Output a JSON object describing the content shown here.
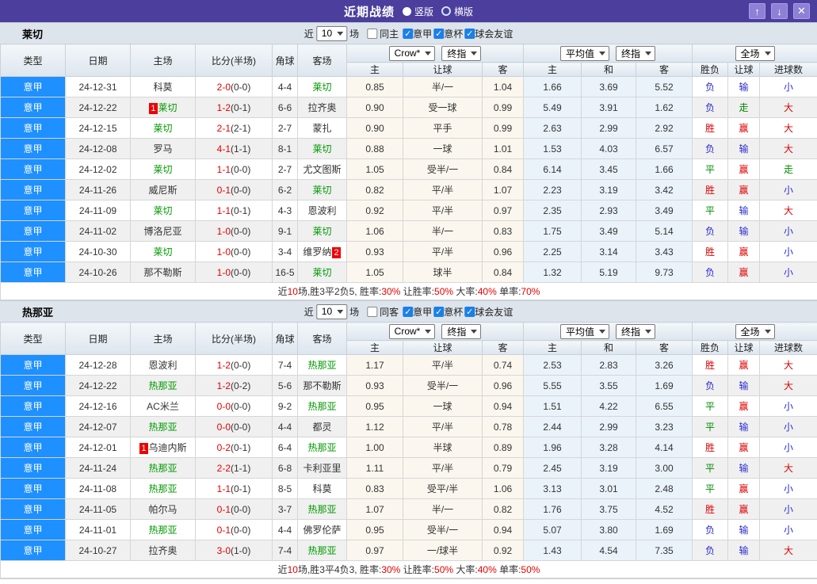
{
  "titlebar": {
    "title": "近期战绩",
    "radio_vertical": "竖版",
    "radio_horizontal": "横版",
    "buttons": {
      "up": "↑",
      "down": "↓",
      "close": "✕"
    }
  },
  "colors": {
    "titlebar_bg": "#4b3e9c",
    "league_cell_bg": "#1e90ff",
    "focal_team": "#009900",
    "score_red": "#e50000",
    "badge_red": "#ee0000",
    "win_red": "#dd0000",
    "draw_green": "#008800",
    "lose_blue": "#2b2bd0"
  },
  "result_color_map": {
    "胜": "win",
    "赢": "win",
    "大": "win",
    "平": "draw",
    "走": "draw",
    "负": "lose",
    "输": "lose",
    "小": "lose"
  },
  "table_header": {
    "cols": [
      "类型",
      "日期",
      "主场",
      "比分(半场)",
      "角球",
      "客场"
    ],
    "group1_selects": [
      "Crow*",
      "终指"
    ],
    "group1_cols": [
      "主",
      "让球",
      "客"
    ],
    "group2_selects": [
      "平均值",
      "终指"
    ],
    "group2_cols": [
      "主",
      "和",
      "客"
    ],
    "group3_select": "全场",
    "group3_cols": [
      "胜负",
      "让球",
      "进球数"
    ]
  },
  "sections": [
    {
      "team": "莱切",
      "filter": {
        "near": "近",
        "count": "10",
        "field": "场",
        "same": {
          "label": "同主",
          "checked": false
        },
        "leagues": [
          {
            "label": "意甲",
            "checked": true
          },
          {
            "label": "意杯",
            "checked": true
          },
          {
            "label": "球会友谊",
            "checked": true
          }
        ]
      },
      "rows": [
        {
          "league": "意甲",
          "date": "24-12-31",
          "home": {
            "name": "科莫"
          },
          "ft": "2-0",
          "ht": "(0-0)",
          "corner": "4-4",
          "away": {
            "name": "莱切",
            "focal": true
          },
          "o1": [
            "0.85",
            "半/一",
            "1.04"
          ],
          "o2": [
            "1.66",
            "3.69",
            "5.52"
          ],
          "res": [
            "负",
            "输",
            "小"
          ]
        },
        {
          "league": "意甲",
          "date": "24-12-22",
          "home": {
            "name": "莱切",
            "focal": true,
            "badge": "1"
          },
          "ft": "1-2",
          "ht": "(0-1)",
          "corner": "6-6",
          "away": {
            "name": "拉齐奥"
          },
          "o1": [
            "0.90",
            "受一球",
            "0.99"
          ],
          "o2": [
            "5.49",
            "3.91",
            "1.62"
          ],
          "res": [
            "负",
            "走",
            "大"
          ]
        },
        {
          "league": "意甲",
          "date": "24-12-15",
          "home": {
            "name": "莱切",
            "focal": true
          },
          "ft": "2-1",
          "ht": "(2-1)",
          "corner": "2-7",
          "away": {
            "name": "蒙扎"
          },
          "o1": [
            "0.90",
            "平手",
            "0.99"
          ],
          "o2": [
            "2.63",
            "2.99",
            "2.92"
          ],
          "res": [
            "胜",
            "赢",
            "大"
          ]
        },
        {
          "league": "意甲",
          "date": "24-12-08",
          "home": {
            "name": "罗马"
          },
          "ft": "4-1",
          "ht": "(1-1)",
          "corner": "8-1",
          "away": {
            "name": "莱切",
            "focal": true
          },
          "o1": [
            "0.88",
            "一球",
            "1.01"
          ],
          "o2": [
            "1.53",
            "4.03",
            "6.57"
          ],
          "res": [
            "负",
            "输",
            "大"
          ]
        },
        {
          "league": "意甲",
          "date": "24-12-02",
          "home": {
            "name": "莱切",
            "focal": true
          },
          "ft": "1-1",
          "ht": "(0-0)",
          "corner": "2-7",
          "away": {
            "name": "尤文图斯"
          },
          "o1": [
            "1.05",
            "受半/一",
            "0.84"
          ],
          "o2": [
            "6.14",
            "3.45",
            "1.66"
          ],
          "res": [
            "平",
            "赢",
            "走"
          ]
        },
        {
          "league": "意甲",
          "date": "24-11-26",
          "home": {
            "name": "威尼斯"
          },
          "ft": "0-1",
          "ht": "(0-0)",
          "corner": "6-2",
          "away": {
            "name": "莱切",
            "focal": true
          },
          "o1": [
            "0.82",
            "平/半",
            "1.07"
          ],
          "o2": [
            "2.23",
            "3.19",
            "3.42"
          ],
          "res": [
            "胜",
            "赢",
            "小"
          ]
        },
        {
          "league": "意甲",
          "date": "24-11-09",
          "home": {
            "name": "莱切",
            "focal": true
          },
          "ft": "1-1",
          "ht": "(0-1)",
          "corner": "4-3",
          "away": {
            "name": "恩波利"
          },
          "o1": [
            "0.92",
            "平/半",
            "0.97"
          ],
          "o2": [
            "2.35",
            "2.93",
            "3.49"
          ],
          "res": [
            "平",
            "输",
            "大"
          ]
        },
        {
          "league": "意甲",
          "date": "24-11-02",
          "home": {
            "name": "博洛尼亚"
          },
          "ft": "1-0",
          "ht": "(0-0)",
          "corner": "9-1",
          "away": {
            "name": "莱切",
            "focal": true
          },
          "o1": [
            "1.06",
            "半/一",
            "0.83"
          ],
          "o2": [
            "1.75",
            "3.49",
            "5.14"
          ],
          "res": [
            "负",
            "输",
            "小"
          ]
        },
        {
          "league": "意甲",
          "date": "24-10-30",
          "home": {
            "name": "莱切",
            "focal": true
          },
          "ft": "1-0",
          "ht": "(0-0)",
          "corner": "3-4",
          "away": {
            "name": "维罗纳",
            "badge_after": "2"
          },
          "o1": [
            "0.93",
            "平/半",
            "0.96"
          ],
          "o2": [
            "2.25",
            "3.14",
            "3.43"
          ],
          "res": [
            "胜",
            "赢",
            "小"
          ]
        },
        {
          "league": "意甲",
          "date": "24-10-26",
          "home": {
            "name": "那不勒斯"
          },
          "ft": "1-0",
          "ht": "(0-0)",
          "corner": "16-5",
          "away": {
            "name": "莱切",
            "focal": true
          },
          "o1": [
            "1.05",
            "球半",
            "0.84"
          ],
          "o2": [
            "1.32",
            "5.19",
            "9.73"
          ],
          "res": [
            "负",
            "赢",
            "小"
          ]
        }
      ],
      "summary": [
        [
          "近",
          "d"
        ],
        [
          "10",
          "r"
        ],
        [
          "场,胜3平2负5, 胜率:",
          "d"
        ],
        [
          "30%",
          "r"
        ],
        [
          " 让胜率:",
          "d"
        ],
        [
          "50%",
          "r"
        ],
        [
          " 大率:",
          "d"
        ],
        [
          "40%",
          "r"
        ],
        [
          " 单率:",
          "d"
        ],
        [
          "70%",
          "r"
        ]
      ]
    },
    {
      "team": "热那亚",
      "filter": {
        "near": "近",
        "count": "10",
        "field": "场",
        "same": {
          "label": "同客",
          "checked": false
        },
        "leagues": [
          {
            "label": "意甲",
            "checked": true
          },
          {
            "label": "意杯",
            "checked": true
          },
          {
            "label": "球会友谊",
            "checked": true
          }
        ]
      },
      "rows": [
        {
          "league": "意甲",
          "date": "24-12-28",
          "home": {
            "name": "恩波利"
          },
          "ft": "1-2",
          "ht": "(0-0)",
          "corner": "7-4",
          "away": {
            "name": "热那亚",
            "focal": true
          },
          "o1": [
            "1.17",
            "平/半",
            "0.74"
          ],
          "o2": [
            "2.53",
            "2.83",
            "3.26"
          ],
          "res": [
            "胜",
            "赢",
            "大"
          ]
        },
        {
          "league": "意甲",
          "date": "24-12-22",
          "home": {
            "name": "热那亚",
            "focal": true
          },
          "ft": "1-2",
          "ht": "(0-2)",
          "corner": "5-6",
          "away": {
            "name": "那不勒斯"
          },
          "o1": [
            "0.93",
            "受半/一",
            "0.96"
          ],
          "o2": [
            "5.55",
            "3.55",
            "1.69"
          ],
          "res": [
            "负",
            "输",
            "大"
          ]
        },
        {
          "league": "意甲",
          "date": "24-12-16",
          "home": {
            "name": "AC米兰"
          },
          "ft": "0-0",
          "ht": "(0-0)",
          "corner": "9-2",
          "away": {
            "name": "热那亚",
            "focal": true
          },
          "o1": [
            "0.95",
            "一球",
            "0.94"
          ],
          "o2": [
            "1.51",
            "4.22",
            "6.55"
          ],
          "res": [
            "平",
            "赢",
            "小"
          ]
        },
        {
          "league": "意甲",
          "date": "24-12-07",
          "home": {
            "name": "热那亚",
            "focal": true
          },
          "ft": "0-0",
          "ht": "(0-0)",
          "corner": "4-4",
          "away": {
            "name": "都灵"
          },
          "o1": [
            "1.12",
            "平/半",
            "0.78"
          ],
          "o2": [
            "2.44",
            "2.99",
            "3.23"
          ],
          "res": [
            "平",
            "输",
            "小"
          ]
        },
        {
          "league": "意甲",
          "date": "24-12-01",
          "home": {
            "name": "乌迪内斯",
            "badge": "1"
          },
          "ft": "0-2",
          "ht": "(0-1)",
          "corner": "6-4",
          "away": {
            "name": "热那亚",
            "focal": true
          },
          "o1": [
            "1.00",
            "半球",
            "0.89"
          ],
          "o2": [
            "1.96",
            "3.28",
            "4.14"
          ],
          "res": [
            "胜",
            "赢",
            "小"
          ]
        },
        {
          "league": "意甲",
          "date": "24-11-24",
          "home": {
            "name": "热那亚",
            "focal": true
          },
          "ft": "2-2",
          "ht": "(1-1)",
          "corner": "6-8",
          "away": {
            "name": "卡利亚里"
          },
          "o1": [
            "1.11",
            "平/半",
            "0.79"
          ],
          "o2": [
            "2.45",
            "3.19",
            "3.00"
          ],
          "res": [
            "平",
            "输",
            "大"
          ]
        },
        {
          "league": "意甲",
          "date": "24-11-08",
          "home": {
            "name": "热那亚",
            "focal": true
          },
          "ft": "1-1",
          "ht": "(0-1)",
          "corner": "8-5",
          "away": {
            "name": "科莫"
          },
          "o1": [
            "0.83",
            "受平/半",
            "1.06"
          ],
          "o2": [
            "3.13",
            "3.01",
            "2.48"
          ],
          "res": [
            "平",
            "赢",
            "小"
          ]
        },
        {
          "league": "意甲",
          "date": "24-11-05",
          "home": {
            "name": "帕尔马"
          },
          "ft": "0-1",
          "ht": "(0-0)",
          "corner": "3-7",
          "away": {
            "name": "热那亚",
            "focal": true
          },
          "o1": [
            "1.07",
            "半/一",
            "0.82"
          ],
          "o2": [
            "1.76",
            "3.75",
            "4.52"
          ],
          "res": [
            "胜",
            "赢",
            "小"
          ]
        },
        {
          "league": "意甲",
          "date": "24-11-01",
          "home": {
            "name": "热那亚",
            "focal": true
          },
          "ft": "0-1",
          "ht": "(0-0)",
          "corner": "4-4",
          "away": {
            "name": "佛罗伦萨"
          },
          "o1": [
            "0.95",
            "受半/一",
            "0.94"
          ],
          "o2": [
            "5.07",
            "3.80",
            "1.69"
          ],
          "res": [
            "负",
            "输",
            "小"
          ]
        },
        {
          "league": "意甲",
          "date": "24-10-27",
          "home": {
            "name": "拉齐奥"
          },
          "ft": "3-0",
          "ht": "(1-0)",
          "corner": "7-4",
          "away": {
            "name": "热那亚",
            "focal": true
          },
          "o1": [
            "0.97",
            "一/球半",
            "0.92"
          ],
          "o2": [
            "1.43",
            "4.54",
            "7.35"
          ],
          "res": [
            "负",
            "输",
            "大"
          ]
        }
      ],
      "summary": [
        [
          "近",
          "d"
        ],
        [
          "10",
          "r"
        ],
        [
          "场,胜3平4负3, 胜率:",
          "d"
        ],
        [
          "30%",
          "r"
        ],
        [
          " 让胜率:",
          "d"
        ],
        [
          "50%",
          "r"
        ],
        [
          " 大率:",
          "d"
        ],
        [
          "40%",
          "r"
        ],
        [
          " 单率:",
          "d"
        ],
        [
          "50%",
          "r"
        ]
      ]
    }
  ]
}
